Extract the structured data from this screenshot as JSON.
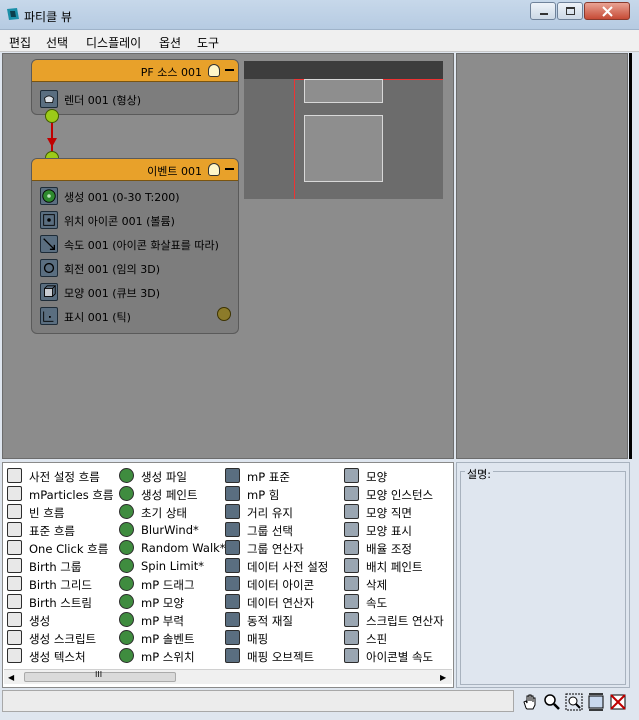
{
  "window": {
    "title": "파티클 뷰",
    "controls": {
      "minimize": "minimize-icon",
      "restore": "restore-icon",
      "close": "close-icon"
    }
  },
  "menu": [
    "편집",
    "선택",
    "디스플레이",
    "옵션",
    "도구"
  ],
  "nodes": {
    "source": {
      "title": "PF 소스 001",
      "operators": [
        {
          "label": "렌더 001 (형상)",
          "icon": "teapot-icon"
        }
      ]
    },
    "event": {
      "title": "이벤트 001",
      "operators": [
        {
          "label": "생성 001 (0-30 T:200)",
          "icon": "birth-icon"
        },
        {
          "label": "위치 아이콘 001 (볼륨)",
          "icon": "position-icon"
        },
        {
          "label": "속도 001 (아이콘 화살표를 따라)",
          "icon": "speed-icon"
        },
        {
          "label": "회전 001 (임의 3D)",
          "icon": "rotation-icon"
        },
        {
          "label": "모양 001 (큐브 3D)",
          "icon": "shape-icon"
        },
        {
          "label": "표시 001 (틱)",
          "icon": "display-icon"
        }
      ]
    }
  },
  "depot": {
    "col1": [
      "사전 설정 흐름",
      "mParticles 흐름",
      "빈 흐름",
      "표준 흐름",
      "One Click 흐름",
      "Birth 그룹",
      "Birth 그리드",
      "Birth 스트림",
      "생성",
      "생성 스크립트",
      "생성 텍스처"
    ],
    "col2": [
      "생성 파일",
      "생성 페인트",
      "초기 상태",
      "BlurWind*",
      "Random Walk*",
      "Spin Limit*",
      "mP 드래그",
      "mP 모양",
      "mP 부력",
      "mP 솔벤트",
      "mP 스위치"
    ],
    "col3": [
      "mP 표준",
      "mP 힘",
      "거리 유지",
      "그룹 선택",
      "그룹 연산자",
      "데이터 사전 설정",
      "데이터 아이콘",
      "데이터 연산자",
      "동적 재질",
      "매핑",
      "매핑 오브젝트"
    ],
    "col4": [
      "모양",
      "모양 인스턴스",
      "모양 직면",
      "모양 표시",
      "배율 조정",
      "배치 페인트",
      "삭제",
      "속도",
      "스크립트 연산자",
      "스핀",
      "아이콘별 속도"
    ]
  },
  "scroll_label": "III",
  "description_label": "설명:",
  "status": "",
  "tools": [
    "pan-icon",
    "zoom-icon",
    "zoom-region-icon",
    "zoom-extents-icon",
    "no-zoom-icon"
  ],
  "colors": {
    "node_header": "#e8a12a",
    "connector": "#9ccb18",
    "wire": "#c00000",
    "canvas": "#8c8c8c"
  }
}
